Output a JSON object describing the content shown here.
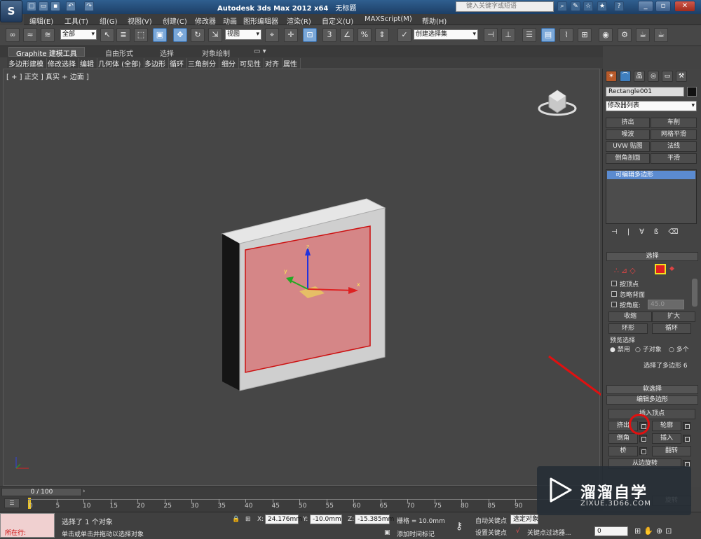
{
  "app": {
    "title": "Autodesk 3ds Max  2012 x64",
    "doc": "无标题",
    "search_placeholder": "键入关键字或短语",
    "logo": "S"
  },
  "menu": [
    "编辑(E)",
    "工具(T)",
    "组(G)",
    "视图(V)",
    "创建(C)",
    "修改器",
    "动画",
    "图形编辑器",
    "渲染(R)",
    "自定义(U)",
    "MAXScript(M)",
    "帮助(H)"
  ],
  "toolbar": {
    "selection_filter": "全部",
    "ref_coord": "视图",
    "named_selection": "创建选择集",
    "snap_label": "3"
  },
  "ribbon": {
    "tabs": [
      "Graphite 建模工具",
      "自由形式",
      "选择",
      "对象绘制"
    ],
    "row": [
      "多边形建模",
      "修改选择",
      "编辑",
      "几何体 (全部)",
      "多边形",
      "循环",
      "三角剖分",
      "细分",
      "可见性",
      "对齐",
      "属性"
    ]
  },
  "viewport": {
    "label": "[ + ] 正交 ] 真实 + 边面 ]",
    "axis_x": "x",
    "axis_y": "y",
    "axis_z": "z"
  },
  "panel": {
    "object_name": "Rectangle001",
    "modifier_list": "修改器列表",
    "mod_buttons": [
      "挤出",
      "车削",
      "噪波",
      "网格平滑",
      "UVW 贴图",
      "法线",
      "倒角剖面",
      "平滑"
    ],
    "stack_item": "可编辑多边形",
    "select_title": "选择",
    "by_vertex": "按顶点",
    "ignore_backface": "忽略背面",
    "by_angle": "按角度:",
    "angle_value": "45.0",
    "shrink": "收缩",
    "grow": "扩大",
    "ring": "环形",
    "loop": "循环",
    "preview": "预览选择",
    "disable": "禁用",
    "subobj": "子对象",
    "multi": "多个",
    "selected_info": "选择了多边形 6",
    "soft_select": "软选择",
    "edit_poly": "编辑多边形",
    "insert_vertex": "插入顶点",
    "extrude": "挤出",
    "outline": "轮廓",
    "bevel": "倒角",
    "inset": "插入",
    "bridge": "桥",
    "flip": "翻转",
    "hinge": "从边旋转",
    "turn": "旋转"
  },
  "timeline": {
    "frame": "0 / 100",
    "ticks": [
      "0",
      "5",
      "10",
      "15",
      "20",
      "25",
      "30",
      "35",
      "40",
      "45",
      "50",
      "55",
      "60",
      "65",
      "70",
      "75",
      "80",
      "85",
      "90"
    ]
  },
  "status": {
    "running": "所在行:",
    "selected": "选择了 1 个对象",
    "hint": "单击或单击并拖动以选择对象",
    "x_label": "X:",
    "x": "24.176mm",
    "y_label": "Y:",
    "y": "-10.0mm",
    "z_label": "Z:",
    "z": "-15.385mm",
    "grid": "栅格 = 10.0mm",
    "auto_key": "自动关键点",
    "set_key": "设置关键点",
    "sel_set": "选定对象",
    "key_filter": "关键点过滤器...",
    "add_time_tag": "添加时间标记",
    "frame_value": "0"
  },
  "watermark": {
    "brand": "溜溜自学",
    "url": "ZIXUE.3D66.COM"
  },
  "colors": {
    "accent": "#7aa7d8",
    "selected_face": "#d58687",
    "annotation": "#e01010"
  }
}
